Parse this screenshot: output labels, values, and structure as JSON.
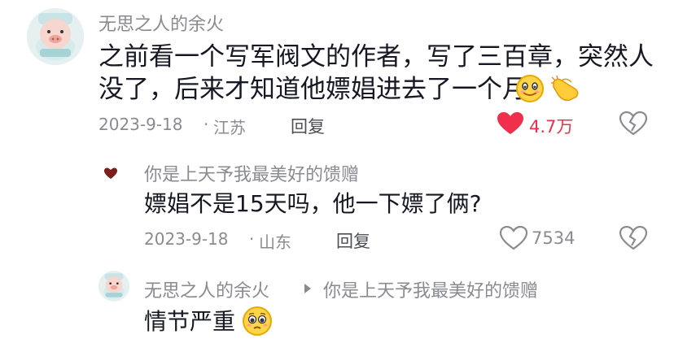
{
  "comments": [
    {
      "user": "无思之人的余火",
      "text_lines": [
        "之前看一个写军阀文的作者，写了三百章，突然人",
        "没了，后来才知道他嫖娼进去了一个月"
      ],
      "date": "2023-9-18",
      "location": "江苏",
      "reply_label": "回复",
      "likes": "4.7万",
      "liked": true,
      "emojis": [
        "smile-emoji",
        "pointing-hand-emoji"
      ]
    },
    {
      "user": "你是上天予我最美好的馈赠",
      "text": "嫖娼不是15天吗，他一下嫖了俩?",
      "date": "2023-9-18",
      "location": "山东",
      "reply_label": "回复",
      "likes": "7534",
      "liked": false
    },
    {
      "user": "无思之人的余火",
      "reply_to": "你是上天予我最美好的馈赠",
      "text": "情节严重",
      "emojis": [
        "pleading-face-emoji"
      ]
    }
  ],
  "colors": {
    "like_active": "#ef2f4b",
    "meta_gray": "#8a8b91",
    "text_dark": "#161823",
    "avatar_bg": "#e7f2f2"
  }
}
